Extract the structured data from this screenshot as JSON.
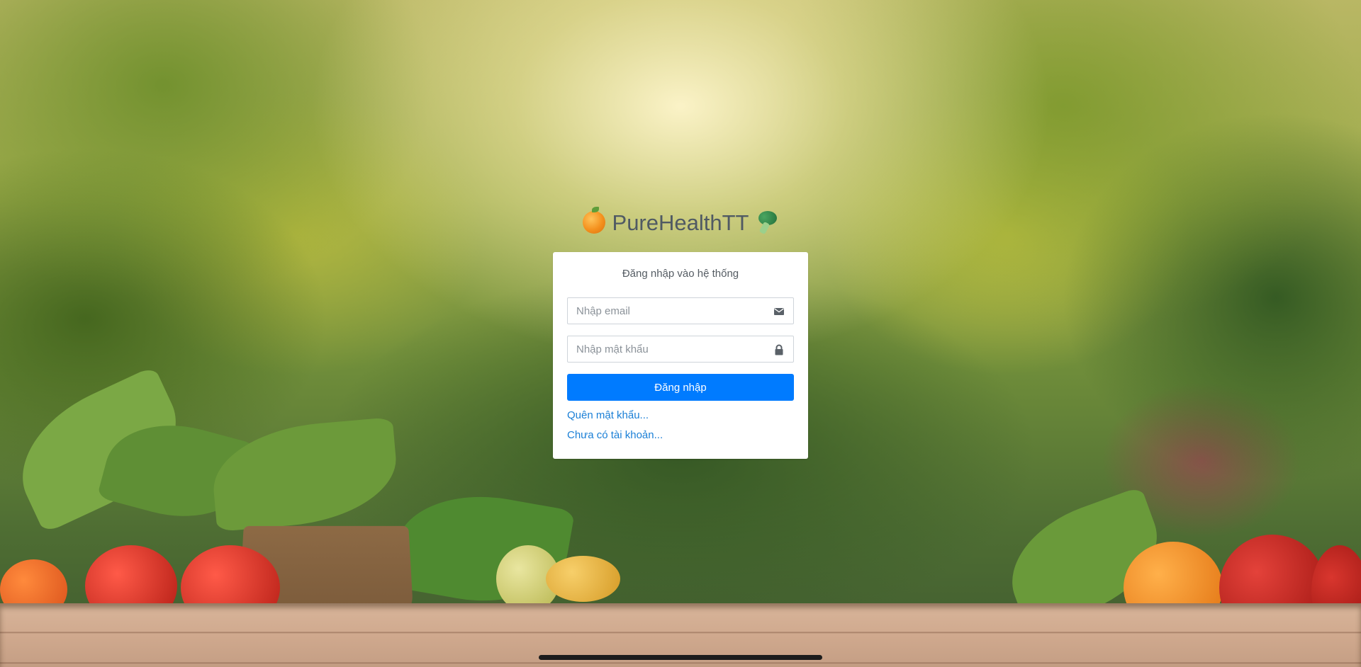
{
  "brand": {
    "name": "PureHealthTT",
    "left_icon": "orange-emoji-icon",
    "right_icon": "broccoli-emoji-icon"
  },
  "login_card": {
    "title": "Đăng nhập vào hệ thống",
    "email": {
      "placeholder": "Nhập email",
      "value": "",
      "icon": "envelope-icon"
    },
    "password": {
      "placeholder": "Nhập mật khẩu",
      "value": "",
      "icon": "lock-icon"
    },
    "submit_label": "Đăng nhập",
    "forgot_password_link": "Quên mật khẩu...",
    "register_link": "Chưa có tài khoản..."
  },
  "colors": {
    "primary": "#007bff",
    "link": "#1a7fd6",
    "brand_text": "#505a63",
    "card_bg": "#ffffff"
  }
}
